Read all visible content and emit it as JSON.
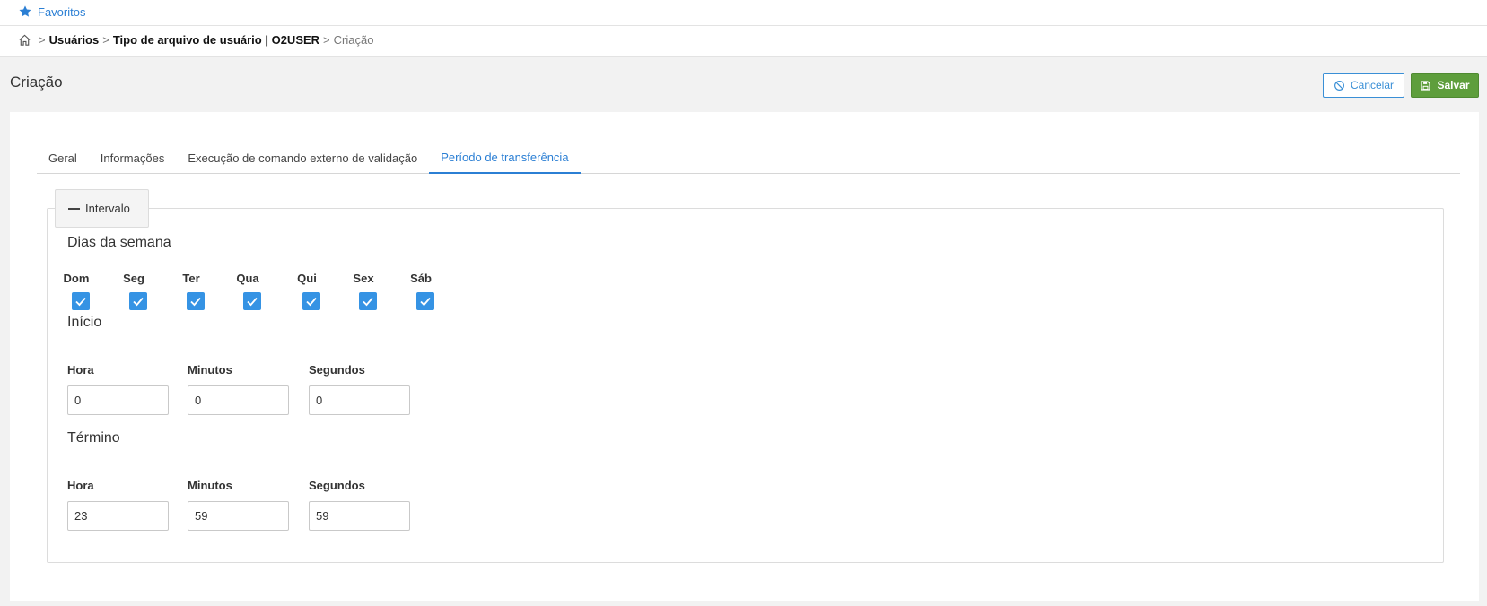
{
  "favorites": {
    "label": "Favoritos",
    "icon": "star-icon"
  },
  "breadcrumb": {
    "items": [
      "Usuários",
      "Tipo de arquivo de usuário | O2USER"
    ],
    "current": "Criação",
    "separator": ">"
  },
  "page": {
    "title": "Criação"
  },
  "actions": {
    "cancel_label": "Cancelar",
    "save_label": "Salvar"
  },
  "tabs": [
    {
      "label": "Geral",
      "active": false
    },
    {
      "label": "Informações",
      "active": false
    },
    {
      "label": "Execução de comando externo de validação",
      "active": false
    },
    {
      "label": "Período de transferência",
      "active": true
    }
  ],
  "interval": {
    "legend": "Intervalo",
    "days_title": "Dias da semana",
    "days": [
      {
        "label": "Dom",
        "checked": true
      },
      {
        "label": "Seg",
        "checked": true
      },
      {
        "label": "Ter",
        "checked": true
      },
      {
        "label": "Qua",
        "checked": true
      },
      {
        "label": "Qui",
        "checked": true
      },
      {
        "label": "Sex",
        "checked": true
      },
      {
        "label": "Sáb",
        "checked": true
      }
    ],
    "start": {
      "title": "Início",
      "hour_label": "Hora",
      "hour_value": "0",
      "minutes_label": "Minutos",
      "minutes_value": "0",
      "seconds_label": "Segundos",
      "seconds_value": "0"
    },
    "end": {
      "title": "Término",
      "hour_label": "Hora",
      "hour_value": "23",
      "minutes_label": "Minutos",
      "minutes_value": "59",
      "seconds_label": "Segundos",
      "seconds_value": "59"
    }
  },
  "colors": {
    "accent": "#2b7fd4",
    "save": "#5e9e3c",
    "checkbox": "#3593e4"
  }
}
